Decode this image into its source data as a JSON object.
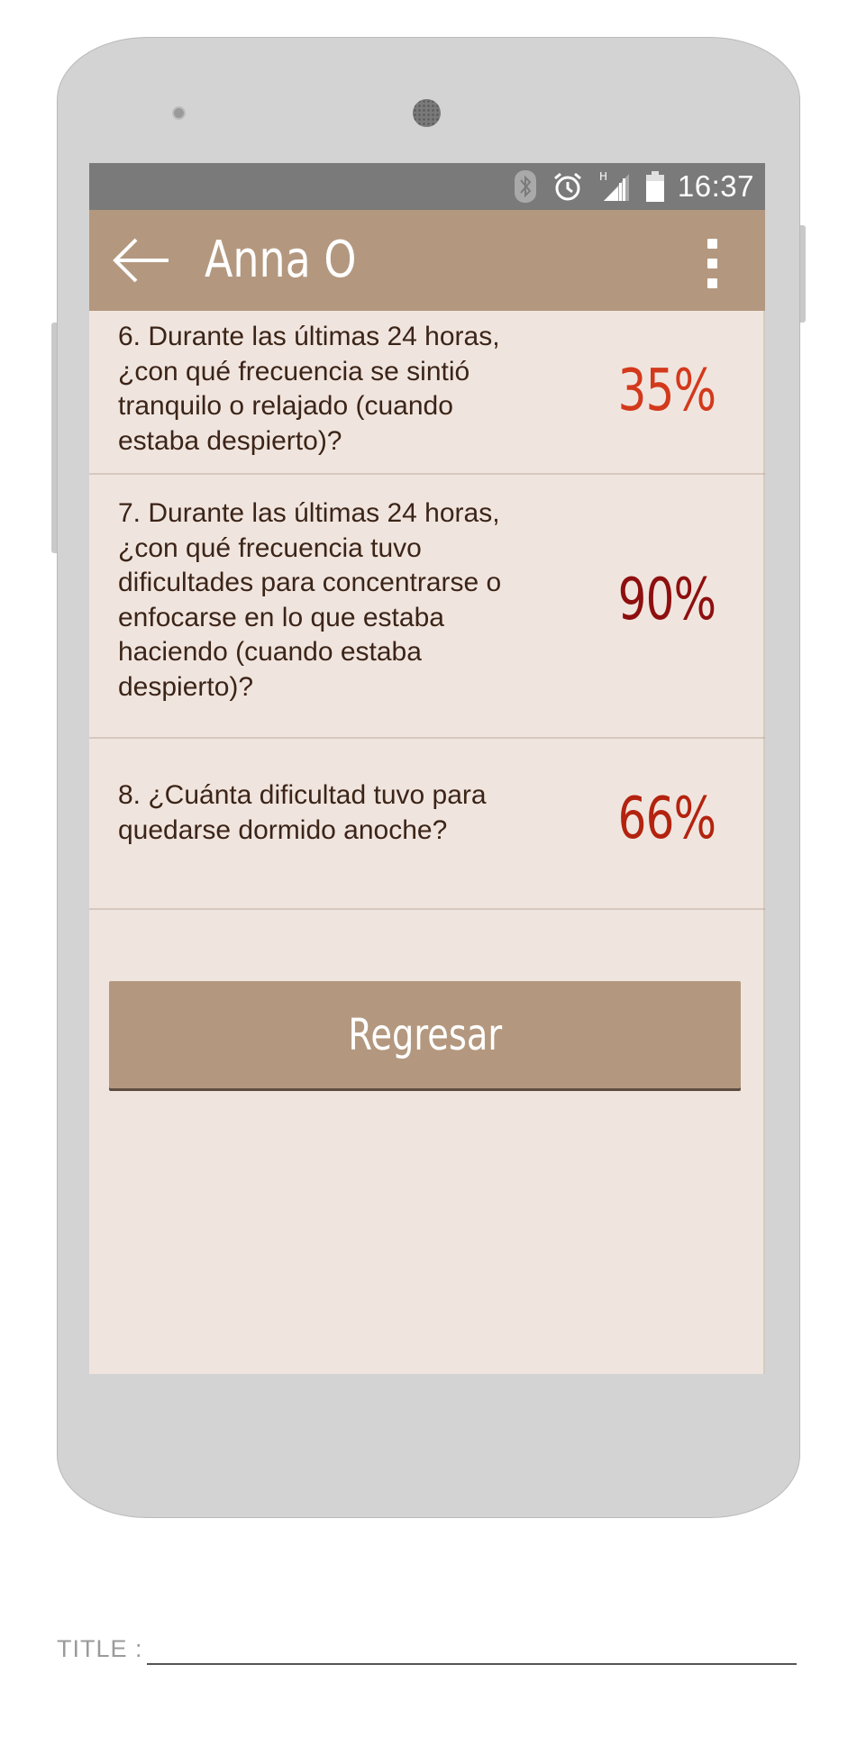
{
  "status_bar": {
    "time": "16:37",
    "network_type": "H",
    "icons": [
      "bluetooth-icon",
      "alarm-icon",
      "signal-icon",
      "battery-icon"
    ]
  },
  "app_bar": {
    "title": "Anna O",
    "back_icon": "arrow-left-icon",
    "menu_icon": "more-vertical-icon"
  },
  "questions": [
    {
      "text": "6. Durante las últimas 24 horas, ¿con qué frecuencia se sintió tranquilo o relajado (cuando estaba despierto)?",
      "value": "35%",
      "color": "#d3391c"
    },
    {
      "text": "7. Durante las últimas 24 horas, ¿con qué frecuencia tuvo dificultades para concentrarse o enfocarse en lo que estaba haciendo (cuando estaba despierto)?",
      "value": "90%",
      "color": "#8e0f0f"
    },
    {
      "text": "8. ¿Cuánta dificultad tuvo para quedarse dormido anoche?",
      "value": "66%",
      "color": "#b3230f"
    }
  ],
  "button": {
    "label": "Regresar"
  },
  "footer": {
    "title_label": "TITLE :"
  },
  "colors": {
    "accent": "#b3987f",
    "background": "#f0e5de",
    "status_bar": "#7a7a7a"
  }
}
